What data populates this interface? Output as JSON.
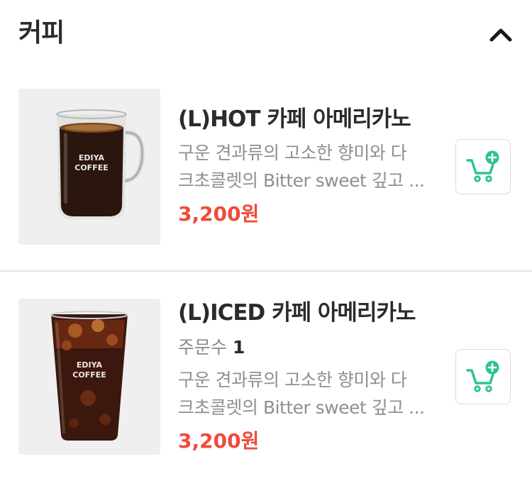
{
  "section": {
    "title": "커피",
    "collapse_icon": "chevron-up-icon"
  },
  "items": [
    {
      "name": "(L)HOT 카페 아메리카노",
      "desc_line1": "구운 견과류의 고소한 향미와 다",
      "desc_line2": "크초콜렛의 Bitter sweet 깊고 ...",
      "price": "3,200원",
      "cup_brand": "EDIYA",
      "cup_brand2": "COFFEE",
      "cart_icon": "cart-add-icon"
    },
    {
      "name": "(L)ICED 카페 아메리카노",
      "order_label": "주문수",
      "order_count": "1",
      "desc_line1": "구운 견과류의 고소한 향미와 다",
      "desc_line2": "크초콜렛의 Bitter sweet 깊고 ...",
      "price": "3,200원",
      "cup_brand": "EDIYA",
      "cup_brand2": "COFFEE",
      "cart_icon": "cart-add-icon"
    }
  ],
  "colors": {
    "price": "#f04a3a",
    "cart_accent": "#2dc48b",
    "text_primary": "#2b2b2b",
    "text_secondary": "#8f8f8f"
  }
}
